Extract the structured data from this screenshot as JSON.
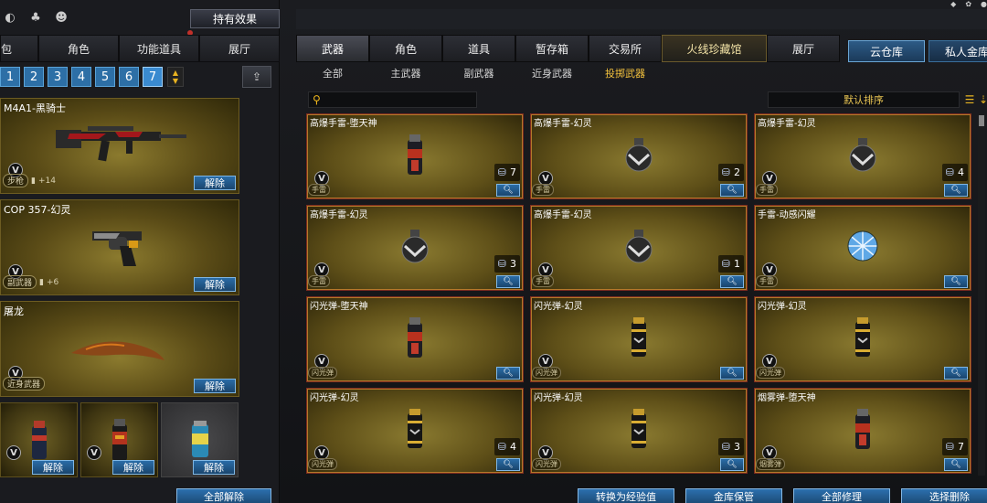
{
  "left": {
    "effect_button": "持有效果",
    "tabs": [
      "包",
      "角色",
      "功能道具",
      "展厅"
    ],
    "pages": [
      "1",
      "2",
      "3",
      "4",
      "5",
      "6",
      "7"
    ],
    "active_page": "7",
    "equipped": [
      {
        "name": "M4A1-黑骑士",
        "tag": "步枪",
        "extra": "+14",
        "unequip": "解除"
      },
      {
        "name": "COP 357-幻灵",
        "tag": "副武器",
        "extra": "+6",
        "unequip": "解除"
      },
      {
        "name": "屠龙",
        "tag": "近身武器",
        "extra": "",
        "unequip": "解除"
      }
    ],
    "small_slots": [
      {
        "unequip": "解除"
      },
      {
        "unequip": "解除"
      },
      {
        "unequip": "解除"
      }
    ],
    "unequip_all": "全部解除"
  },
  "right": {
    "main_tabs": [
      "武器",
      "角色",
      "道具",
      "暂存箱",
      "交易所",
      "火线珍藏馆",
      "展厅"
    ],
    "store_tabs": [
      "云仓库",
      "私人金库"
    ],
    "sub_tabs": [
      "全部",
      "主武器",
      "副武器",
      "近身武器",
      "投掷武器"
    ],
    "active_sub_tab": "投掷武器",
    "search_placeholder": "",
    "sort_label": "默认排序",
    "items": [
      {
        "name": "高爆手雷-堕天神",
        "cat": "手雷",
        "count": "7",
        "art": "canister-red"
      },
      {
        "name": "高爆手雷-幻灵",
        "cat": "手雷",
        "count": "2",
        "art": "grenade"
      },
      {
        "name": "高爆手雷-幻灵",
        "cat": "手雷",
        "count": "4",
        "art": "grenade"
      },
      {
        "name": "高爆手雷-幻灵",
        "cat": "手雷",
        "count": "3",
        "art": "grenade"
      },
      {
        "name": "高爆手雷-幻灵",
        "cat": "手雷",
        "count": "1",
        "art": "grenade"
      },
      {
        "name": "手雷-动感闪耀",
        "cat": "手雷",
        "count": "",
        "art": "disco"
      },
      {
        "name": "闪光弹-堕天神",
        "cat": "闪光弹",
        "count": "",
        "art": "canister-red"
      },
      {
        "name": "闪光弹-幻灵",
        "cat": "闪光弹",
        "count": "",
        "art": "canister-gold"
      },
      {
        "name": "闪光弹-幻灵",
        "cat": "闪光弹",
        "count": "",
        "art": "canister-gold"
      },
      {
        "name": "闪光弹-幻灵",
        "cat": "闪光弹",
        "count": "4",
        "art": "canister-gold"
      },
      {
        "name": "闪光弹-幻灵",
        "cat": "闪光弹",
        "count": "3",
        "art": "canister-gold"
      },
      {
        "name": "烟雾弹-堕天神",
        "cat": "烟雾弹",
        "count": "7",
        "art": "canister-red"
      }
    ],
    "bottom_buttons": [
      "转换为经验值",
      "金库保管",
      "全部修理",
      "选择删除"
    ]
  }
}
